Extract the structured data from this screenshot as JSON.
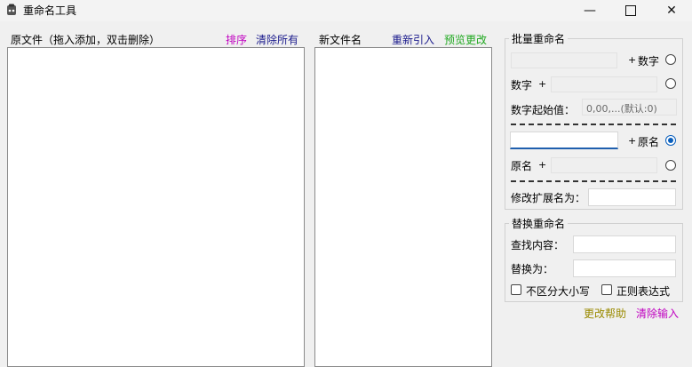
{
  "window": {
    "title": "重命名工具",
    "icon": "app-icon",
    "controls": {
      "minimize": "—",
      "close": "✕"
    }
  },
  "left_panel": {
    "header": "原文件（拖入添加，双击删除）",
    "sort_link": "排序",
    "clear_all_link": "清除所有"
  },
  "middle_panel": {
    "header": "新文件名",
    "reimport_link": "重新引入",
    "preview_link": "预览更改"
  },
  "batch_rename": {
    "title": "批量重命名",
    "row1": {
      "plus": "+",
      "label": "数字"
    },
    "row2": {
      "label": "数字",
      "plus": "+"
    },
    "start_value": {
      "label": "数字起始值：",
      "placeholder": "0,00,...(默认:0)"
    },
    "row3": {
      "plus": "+",
      "label": "原名"
    },
    "row4": {
      "label": "原名",
      "plus": "+"
    },
    "ext": {
      "label": "修改扩展名为："
    }
  },
  "replace_rename": {
    "title": "替换重命名",
    "find_label": "查找内容：",
    "replace_label": "替换为：",
    "case_insensitive": "不区分大小写",
    "regex": "正则表达式"
  },
  "footer": {
    "help_link": "更改帮助",
    "clear_input_link": "清除输入"
  },
  "colors": {
    "magenta_link": "#c000c0",
    "navy_link": "#1a1a8c",
    "green_link": "#1fa81f",
    "olive_link": "#9a8a00",
    "radio_accent": "#0a5fbd"
  }
}
